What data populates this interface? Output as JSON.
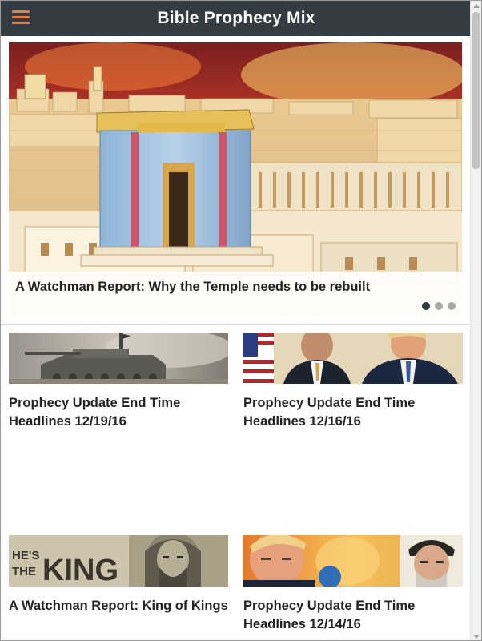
{
  "app": {
    "title": "Bible Prophecy Mix",
    "accent_color": "#e87d43",
    "header_color": "#333b43"
  },
  "header": {
    "menu_icon": "hamburger-menu-icon"
  },
  "slider": {
    "caption": "A Watchman Report: Why the Temple needs to be rebuilt",
    "slide_count": 3,
    "active_index": 0
  },
  "articles": [
    {
      "title": "Prophecy Update End Time Headlines 12/19/16"
    },
    {
      "title": "Prophecy Update End Time Headlines 12/16/16"
    },
    {
      "title": "A Watchman Report: King of Kings",
      "thumb_text": [
        "HE'S",
        "THE",
        "KING"
      ]
    },
    {
      "title": "Prophecy Update End Time Headlines 12/14/16"
    }
  ]
}
